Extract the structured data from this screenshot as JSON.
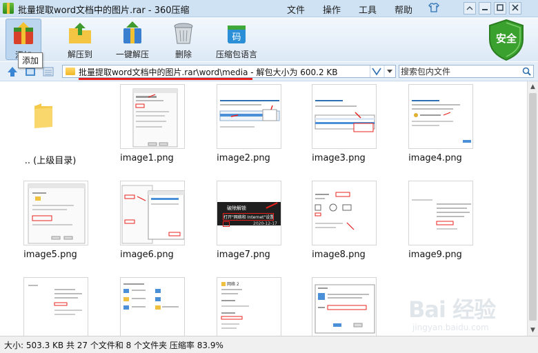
{
  "window": {
    "title": "批量提取word文档中的图片.rar - 360压缩"
  },
  "menu": [
    "文件",
    "操作",
    "工具",
    "帮助"
  ],
  "toolbar": {
    "buttons": [
      {
        "label": "添加",
        "icon": "add-archive-icon"
      },
      {
        "label": "解压到",
        "icon": "extract-to-icon"
      },
      {
        "label": "一键解压",
        "icon": "one-click-extract-icon"
      },
      {
        "label": "删除",
        "icon": "trash-icon"
      },
      {
        "label": "压缩包语言",
        "icon": "archive-language-icon"
      }
    ],
    "tooltip": "添加",
    "security_badge": "安全"
  },
  "address": {
    "path": "批量提取word文档中的图片.rar\\word\\media - 解包大小为 600.2 KB",
    "search_placeholder": "搜索包内文件"
  },
  "files": [
    {
      "name": ".. (上级目录)",
      "type": "folder"
    },
    {
      "name": "image1.png",
      "type": "image"
    },
    {
      "name": "image2.png",
      "type": "image"
    },
    {
      "name": "image3.png",
      "type": "image"
    },
    {
      "name": "image4.png",
      "type": "image"
    },
    {
      "name": "image5.png",
      "type": "image"
    },
    {
      "name": "image6.png",
      "type": "image"
    },
    {
      "name": "image7.png",
      "type": "image"
    },
    {
      "name": "image8.png",
      "type": "image"
    },
    {
      "name": "image9.png",
      "type": "image"
    },
    {
      "name": "",
      "type": "image"
    },
    {
      "name": "",
      "type": "image"
    },
    {
      "name": "",
      "type": "image"
    },
    {
      "name": "",
      "type": "image"
    }
  ],
  "thumb_texts": {
    "image7_title": "破除解锁",
    "image7_banner": "打开\"网络和 Internet\"设置",
    "image7_date": "2020-12-17",
    "image12_title": "网络 2"
  },
  "status": {
    "text": "大小: 503.3 KB 共 27 个文件和 8 个文件夹 压缩率 83.9%"
  },
  "watermark": {
    "brand": "Bai 经验",
    "site": "jingyan.baidu.com"
  },
  "colors": {
    "accent_blue": "#cfe2f3",
    "highlight_red": "#e8201c",
    "shield_green": "#3aa02e"
  }
}
